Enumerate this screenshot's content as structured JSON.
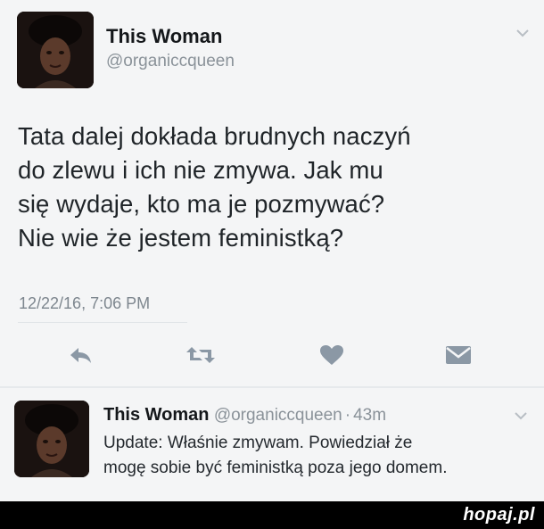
{
  "tweet": {
    "author_name": "This Woman",
    "author_handle": "@organiccqueen",
    "text_lines": [
      "Tata dalej dokłada brudnych naczyń",
      "do zlewu i ich nie zmywa. Jak mu",
      "się wydaje, kto ma je pozmywać?",
      "Nie wie że jestem feministką?"
    ],
    "timestamp": "12/22/16, 7:06 PM",
    "actions": [
      "reply-icon",
      "retweet-icon",
      "like-icon",
      "dm-icon"
    ]
  },
  "reply": {
    "author_name": "This Woman",
    "author_handle": "@organiccqueen",
    "time_sep": "·",
    "age": "43m",
    "text_lines": [
      "Update: Właśnie zmywam. Powiedział że",
      "mogę sobie być feministką poza jego domem."
    ]
  },
  "watermark": {
    "brand_main": "hopaj",
    "brand_suffix": ".pl"
  },
  "colors": {
    "background": "#f4f5f6",
    "icon": "#8b98a5",
    "footer": "#000000"
  }
}
